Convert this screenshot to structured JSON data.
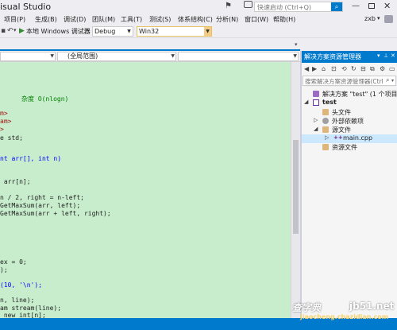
{
  "window": {
    "title": "isual Studio",
    "quick_launch_placeholder": "快速启动 (Ctrl+Q)",
    "minimize": "—",
    "close": "✕"
  },
  "menu": {
    "items": [
      "项目(P)",
      "生成(B)",
      "调试(D)",
      "团队(M)",
      "工具(T)",
      "测试(S)",
      "体系结构(C)",
      "分析(N)",
      "窗口(W)",
      "帮助(H)"
    ],
    "user": "zxb"
  },
  "toolbar": {
    "debugger_label": "本地 Windows 调试器",
    "configuration": "Debug",
    "platform": "Win32"
  },
  "navbar": {
    "scope": "(全局范围)"
  },
  "editor": {
    "lines": [
      {
        "text": "杂度 O(nlogn)",
        "kind": "comment",
        "indent": 27
      },
      {
        "text": "m>",
        "kind": "string",
        "indent": 0
      },
      {
        "text": "am>",
        "kind": "string",
        "indent": 0
      },
      {
        "text": ">",
        "kind": "string",
        "indent": 0
      },
      {
        "text": "e std;",
        "kind": "plain",
        "indent": 0
      },
      {
        "text": "nt arr[], int n)",
        "kind": "mixed",
        "indent": 0
      },
      {
        "text": " arr[n];",
        "kind": "plain",
        "indent": 0
      },
      {
        "text": "n / 2, right = n-left;",
        "kind": "plain",
        "indent": 0
      },
      {
        "text": "GetMaxSum(arr, left);",
        "kind": "plain",
        "indent": 0
      },
      {
        "text": "GetMaxSum(arr + left, right);",
        "kind": "plain",
        "indent": 0
      },
      {
        "text": "ex = 0;",
        "kind": "plain",
        "indent": 0
      },
      {
        "text": ");",
        "kind": "plain",
        "indent": 0
      },
      {
        "text": "(10, '\\n');",
        "kind": "mixed",
        "indent": 0
      },
      {
        "text": "n, line);",
        "kind": "plain",
        "indent": 0
      },
      {
        "text": "am stream(line);",
        "kind": "plain",
        "indent": 0
      },
      {
        "text": " new int[n];",
        "kind": "plain",
        "indent": 0
      }
    ]
  },
  "solution_explorer": {
    "title": "解决方案资源管理器",
    "search_placeholder": "搜索解决方案资源管理器(Ctrl",
    "tree": [
      {
        "label": "解决方案 \"test\" (1 个项目)",
        "icon": "solution-icon",
        "level": 0,
        "arrow": "",
        "bold": false
      },
      {
        "label": "test",
        "icon": "project-icon",
        "level": 0,
        "arrow": "◢",
        "bold": true
      },
      {
        "label": "头文件",
        "icon": "folder-icon",
        "level": 1,
        "arrow": "",
        "bold": false
      },
      {
        "label": "外部依赖项",
        "icon": "reference-icon",
        "level": 1,
        "arrow": "▷",
        "bold": false
      },
      {
        "label": "源文件",
        "icon": "folder-icon",
        "level": 1,
        "arrow": "◢",
        "bold": false
      },
      {
        "label": "main.cpp",
        "icon": "cpp-file-icon",
        "level": 2,
        "arrow": "▷",
        "bold": false,
        "selected": true
      },
      {
        "label": "资源文件",
        "icon": "folder-icon",
        "level": 1,
        "arrow": "",
        "bold": false
      }
    ]
  },
  "watermark": {
    "line1": "查字典",
    "line2": "jb51.net",
    "line3": "jiaocheng.chazidian.com"
  },
  "colors": {
    "accent": "#007acc",
    "editor_bg": "#c7edcc",
    "comment": "#008000",
    "string": "#a31515",
    "keyword": "#0000ff"
  }
}
